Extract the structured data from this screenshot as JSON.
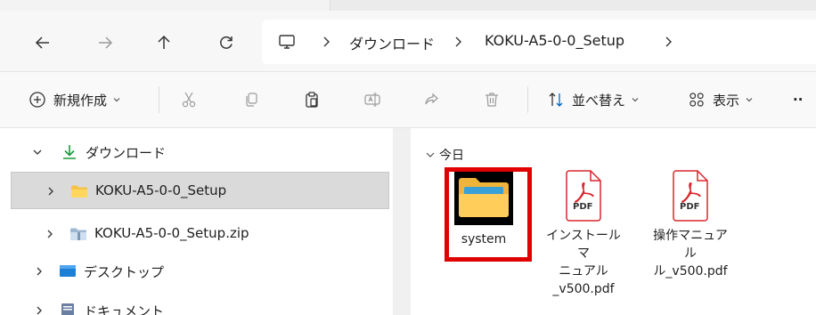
{
  "nav": {
    "breadcrumbs": [
      "ダウンロード",
      "KOKU-A5-0-0_Setup"
    ],
    "icons": [
      "back-arrow-icon",
      "forward-arrow-icon",
      "up-arrow-icon",
      "refresh-icon",
      "this-pc-icon"
    ]
  },
  "toolbar": {
    "new_label": "新規作成",
    "sort_label": "並べ替え",
    "view_label": "表示",
    "more_label": "··"
  },
  "sidebar": {
    "items": [
      {
        "label": "ダウンロード",
        "icon": "download-icon",
        "expanded": true
      },
      {
        "label": "KOKU-A5-0-0_Setup",
        "icon": "folder-icon",
        "selected": true
      },
      {
        "label": "KOKU-A5-0-0_Setup.zip",
        "icon": "zip-folder-icon"
      },
      {
        "label": "デスクトップ",
        "icon": "desktop-icon"
      },
      {
        "label": "ドキュメント",
        "icon": "documents-icon"
      }
    ]
  },
  "content": {
    "group_label": "今日",
    "files": [
      {
        "name": "system",
        "icon": "folder-icon"
      },
      {
        "name": "インストールマニュアル_v500.pdf",
        "name_lines": [
          "インストールマ",
          "ニュアル",
          "_v500.pdf"
        ],
        "icon": "pdf-icon",
        "badge": "PDF"
      },
      {
        "name": "操作マニュアル_v500.pdf",
        "name_lines": [
          "操作マニュアル",
          "ル_v500.pdf"
        ],
        "icon": "pdf-icon",
        "badge": "PDF"
      }
    ]
  },
  "colors": {
    "accent": "#0067c0",
    "pdf_red": "#d9262c",
    "folder": "#f5c344",
    "highlight": "#e00000",
    "selected_bg": "#dadada"
  }
}
